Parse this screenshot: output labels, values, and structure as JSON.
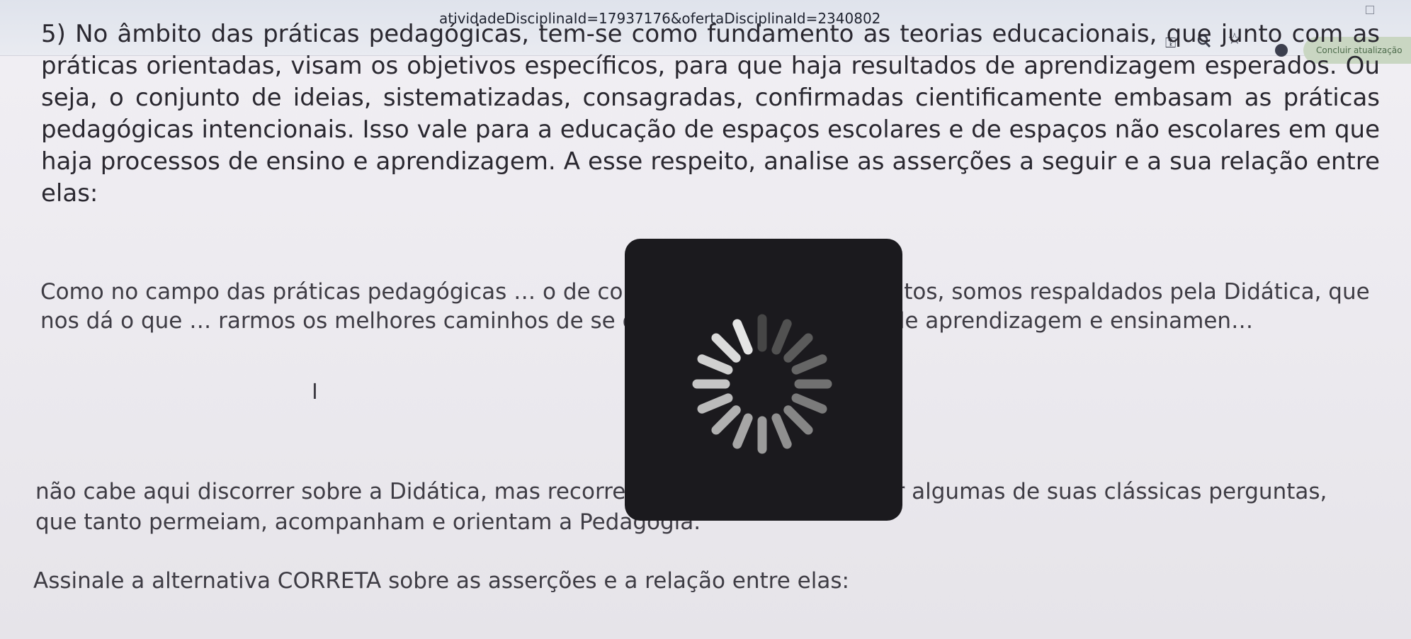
{
  "browser": {
    "url": "atividadeDisciplinaId=17937176&ofertaDisciplinaId=2340802",
    "update_button_label": "Concluir atualização"
  },
  "question": {
    "text": "5) No âmbito das práticas pedagógicas, tem-se como fundamento as teorias educacionais, que junto com as práticas orientadas, visam os objetivos específicos, para que haja resultados de aprendizagem esperados. Ou seja, o conjunto de ideias, sistematizadas, consagradas, confirmadas cientificamente embasam as práticas pedagógicas intencionais. Isso vale para a educação de espaços escolares e de espaços não escolares em que haja processos de ensino e aprendizagem. A esse respeito, analise as asserções a seguir e a sua relação entre elas:"
  },
  "assertion_1": {
    "text": "Como no campo das práticas pedagógicas … o de conhecimentos e fundamentos, somos respaldados pela Didática, que nos dá o que … rarmos os melhores caminhos de se oferecer boas situações de aprendizagem e ensinamen…"
  },
  "assertion_2": {
    "text": "não cabe aqui discorrer sobre a Didática, mas recorremos a ela para relembrar algumas de suas clássicas perguntas, que tanto permeiam, acompanham e orientam a Pedagogia."
  },
  "instruction": {
    "text": "Assinale a alternativa CORRETA sobre as asserções e a relação entre elas:"
  },
  "icons": [
    "key-icon",
    "zoom-icon",
    "star-icon",
    "avatar",
    "restore-icon",
    "loading-spinner-icon"
  ],
  "colors": {
    "background": "#ebe9ee",
    "text": "#2a2830",
    "loader_overlay": "#1b1a1e",
    "update_button": "#c9d6c2"
  }
}
